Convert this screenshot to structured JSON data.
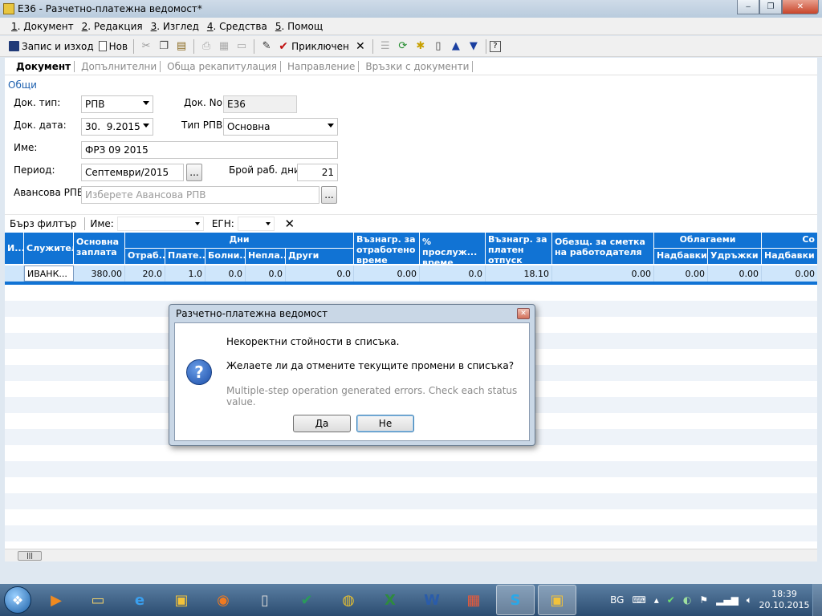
{
  "window": {
    "title": "Е36 - Разчетно-платежна ведомост*",
    "minimize_glyph": "‒",
    "restore_glyph": "❐",
    "close_glyph": "✕"
  },
  "menu": [
    {
      "key": "1",
      "label": ". Документ"
    },
    {
      "key": "2",
      "label": ". Редакция"
    },
    {
      "key": "3",
      "label": ". Изглед"
    },
    {
      "key": "4",
      "label": ". Средства"
    },
    {
      "key": "5",
      "label": ". Помощ"
    }
  ],
  "toolbar": {
    "save_exit": "Запис и изход",
    "new": "Нов",
    "accepted": "Приключен"
  },
  "tabs": [
    {
      "label": "Документ",
      "active": true
    },
    {
      "label": "Допълнителни",
      "active": false
    },
    {
      "label": "Обща рекапитулация",
      "active": false
    },
    {
      "label": "Направление",
      "active": false
    },
    {
      "label": "Връзки с документи",
      "active": false
    }
  ],
  "group": "Общи",
  "form": {
    "doc_type_label": "Док. тип:",
    "doc_type_value": "РПВ",
    "doc_no_label": "Док. No.",
    "doc_no_value": "Е36",
    "doc_date_label": "Док. дата:",
    "doc_date_value": "30.  9.2015",
    "rpv_type_label": "Тип РПВ:",
    "rpv_type_value": "Основна",
    "name_label": "Име:",
    "name_value": "ФРЗ 09 2015",
    "period_label": "Период:",
    "period_value": "Септември/2015",
    "workdays_label": "Брой раб. дни:",
    "workdays_value": "21",
    "advance_label": "Авансова РПВ:",
    "advance_placeholder": "Изберете Авансова РПВ",
    "ellipsis": "..."
  },
  "filter": {
    "quick_filter": "Бърз филтър",
    "name_label": "Име:",
    "egn_label": "ЕГН:",
    "clear_glyph": "✕"
  },
  "grid": {
    "headers": {
      "id": "И...",
      "employee": "Служител",
      "base_salary": "Основна заплата",
      "days": "Дни",
      "worked": "Отраб...",
      "paid": "Плате...",
      "sick": "Болни...",
      "unpaid": "Непла...",
      "other": "Други",
      "remun_worked": "Възнагр. за отработено време",
      "seniority": "% прослуж... време",
      "remun_paid_leave": "Възнагр. за платен отпуск",
      "employer_comp": "Обезщ. за сметка на работодателя",
      "taxable": "Облагаеми",
      "additions": "Надбавки",
      "deductions": "Удръжки",
      "next_group": "Со",
      "additions2": "Надбавки"
    },
    "row": {
      "employee": "ИВАНК...",
      "base_salary": "380.00",
      "worked": "20.0",
      "paid": "1.0",
      "sick": "0.0",
      "unpaid": "0.0",
      "other": "0.0",
      "remun_worked": "0.00",
      "seniority": "0.0",
      "remun_paid_leave": "18.10",
      "employer_comp": "0.00",
      "additions": "0.00",
      "deductions": "0.00",
      "additions2": "0.00"
    }
  },
  "dialog": {
    "title": "Разчетно-платежна ведомост",
    "line1": "Некоректни стойности в списъка.",
    "line2": "Желаете ли да отмените текущите промени в списъка?",
    "line3": "Multiple-step operation generated errors. Check each status value.",
    "yes": "Да",
    "no": "Не",
    "icon_glyph": "?"
  },
  "taskbar": {
    "lang": "BG",
    "time": "18:39",
    "date": "20.10.2015"
  },
  "colors": {
    "grid_header": "#1173d4",
    "selected_row": "#cfe6fb",
    "group_link": "#1c5fae"
  }
}
